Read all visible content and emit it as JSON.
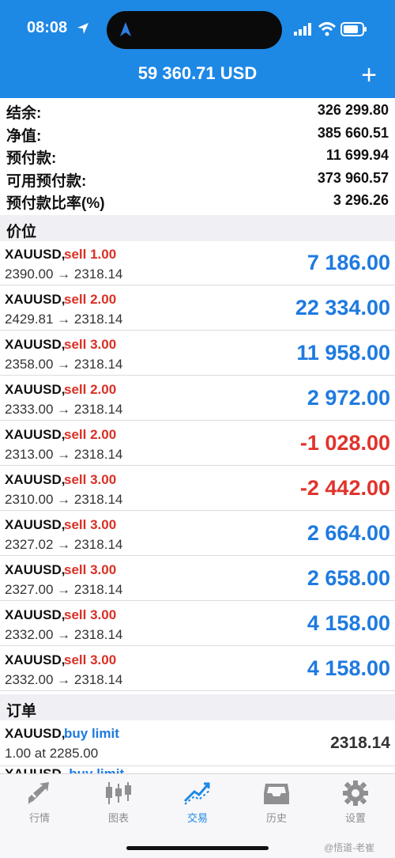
{
  "status_bar": {
    "time": "08:08"
  },
  "header": {
    "title": "59 360.71 USD",
    "plus": "+"
  },
  "summary": [
    {
      "label": "结余:",
      "value": "326 299.80"
    },
    {
      "label": "净值:",
      "value": "385 660.51"
    },
    {
      "label": "预付款:",
      "value": "11 699.94"
    },
    {
      "label": "可用预付款:",
      "value": "373 960.57"
    },
    {
      "label": "预付款比率(%)",
      "value": "3 296.26"
    }
  ],
  "positions_section": "价位",
  "positions": [
    {
      "symbol": "XAUUSD,",
      "side": "sell 1.00",
      "prices": "2390.00 → 2318.14",
      "profit": "7 186.00"
    },
    {
      "symbol": "XAUUSD,",
      "side": "sell 2.00",
      "prices": "2429.81 → 2318.14",
      "profit": "22 334.00"
    },
    {
      "symbol": "XAUUSD,",
      "side": "sell 3.00",
      "prices": "2358.00 → 2318.14",
      "profit": "11 958.00"
    },
    {
      "symbol": "XAUUSD,",
      "side": "sell 2.00",
      "prices": "2333.00 → 2318.14",
      "profit": "2 972.00"
    },
    {
      "symbol": "XAUUSD,",
      "side": "sell 2.00",
      "prices": "2313.00 → 2318.14",
      "profit": "-1 028.00"
    },
    {
      "symbol": "XAUUSD,",
      "side": "sell 3.00",
      "prices": "2310.00 → 2318.14",
      "profit": "-2 442.00"
    },
    {
      "symbol": "XAUUSD,",
      "side": "sell 3.00",
      "prices": "2327.02 → 2318.14",
      "profit": "2 664.00"
    },
    {
      "symbol": "XAUUSD,",
      "side": "sell 3.00",
      "prices": "2327.00 → 2318.14",
      "profit": "2 658.00"
    },
    {
      "symbol": "XAUUSD,",
      "side": "sell 3.00",
      "prices": "2332.00 → 2318.14",
      "profit": "4 158.00"
    },
    {
      "symbol": "XAUUSD,",
      "side": "sell 3.00",
      "prices": "2332.00 → 2318.14",
      "profit": "4 158.00"
    }
  ],
  "orders_section": "订单",
  "orders": [
    {
      "symbol": "XAUUSD,",
      "side": "buy limit",
      "detail": "1.00 at 2285.00",
      "price": "2318.14"
    },
    {
      "symbol": "XAUUSD,",
      "side": "buy limit"
    }
  ],
  "tabs": [
    {
      "label": "行情",
      "icon": "quotes-icon"
    },
    {
      "label": "图表",
      "icon": "chart-icon"
    },
    {
      "label": "交易",
      "icon": "trade-icon"
    },
    {
      "label": "历史",
      "icon": "history-icon"
    },
    {
      "label": "设置",
      "icon": "settings-icon"
    }
  ],
  "active_tab": "交易",
  "watermark": "@悟道-老崔",
  "colors": {
    "header": "#1e88e5",
    "profit": "#1e7ae0",
    "loss": "#e0332c",
    "sell": "#d93025",
    "buy": "#1e7ae0"
  }
}
